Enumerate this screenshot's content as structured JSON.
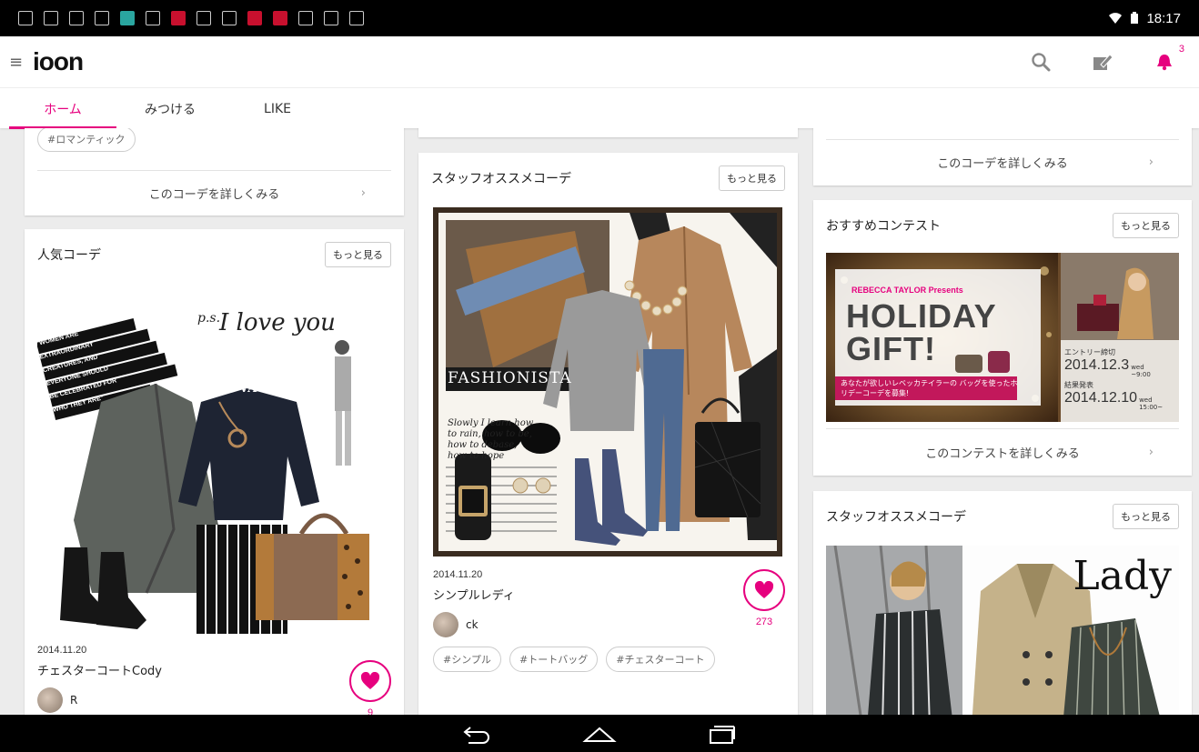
{
  "status_bar": {
    "time": "18:17"
  },
  "app": {
    "logo": "ioon",
    "notification_count": "3"
  },
  "tabs": [
    {
      "label": "ホーム",
      "active": true
    },
    {
      "label": "みつける",
      "active": false
    },
    {
      "label": "LIKE",
      "active": false
    }
  ],
  "col1": {
    "top_tag": "#ロマンティック",
    "top_detail": "このコーデを詳しくみる",
    "popular": {
      "title": "人気コーデ",
      "more": "もっと見る",
      "date": "2014.11.20",
      "name": "チェスターコートCody",
      "user": "R",
      "likes": "9",
      "art": {
        "ps": "p.s.",
        "script": "I love you",
        "sweater": "VAGUE",
        "quote": [
          "\"WOMEN ARE",
          "EXTRAORDINARY",
          "CREATURES, AND",
          "EVERYONE SHOULD",
          "BE CELEBRATED FOR",
          "WHO THEY ARE\""
        ]
      }
    }
  },
  "col2": {
    "staff": {
      "title": "スタッフオススメコーデ",
      "more": "もっと見る",
      "date": "2014.11.20",
      "name": "シンプルレディ",
      "user": "ck",
      "likes": "273",
      "tags": [
        "#シンプル",
        "#トートバッグ",
        "#チェスターコート"
      ],
      "art": {
        "banner": "FASHIONISTA",
        "caption": "Slowly I learn how to rain, how to be, how to debase, how to hope"
      }
    }
  },
  "col3": {
    "top_detail": "このコーデを詳しくみる",
    "contest": {
      "title": "おすすめコンテスト",
      "more": "もっと見る",
      "brand": "REBECCA TAYLOR Presents",
      "headline1": "HOLIDAY",
      "headline2": "GIFT!",
      "desc": "あなたが欲しいレベッカテイラーの バッグを使ったホリデーコーデを募集!",
      "entry_label": "エントリー締切",
      "entry_date": "2014.12.3",
      "entry_time": "wed ~9:00",
      "result_label": "結果発表",
      "result_date": "2014.12.10",
      "result_time": "wed 15:00~",
      "detail": "このコンテストを詳しくみる"
    },
    "staff": {
      "title": "スタッフオススメコーデ",
      "more": "もっと見る",
      "art": {
        "word": "Lady"
      }
    }
  },
  "colors": {
    "accent": "#e6007e"
  }
}
